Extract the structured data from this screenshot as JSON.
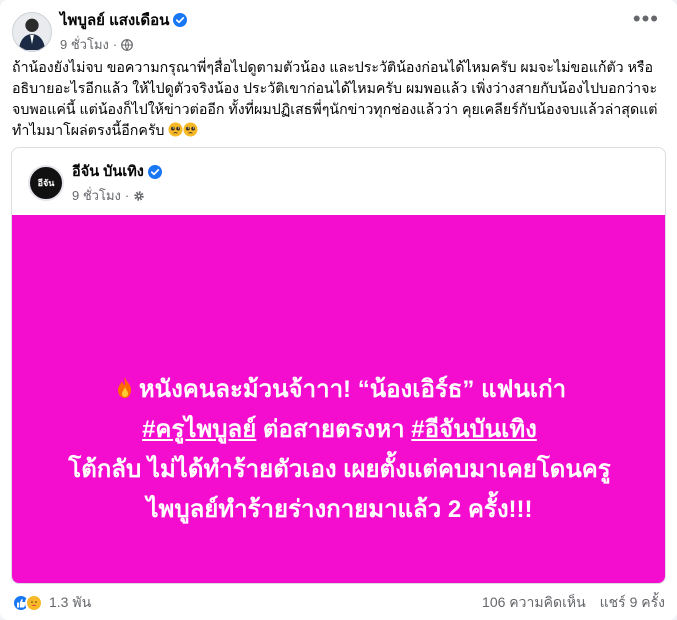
{
  "post": {
    "author": "ไพบูลย์ แสงเดือน",
    "time": "9 ชั่วโมง",
    "dot": "·",
    "more_label": "•••",
    "text": "ถ้าน้องยังไม่จบ ขอความกรุณาพี่ๆสื่อไปดูตามตัวน้อง และประวัติน้องก่อนได้ไหมครับ ผมจะไม่ขอแก้ตัว หรืออธิบายอะไรอีกแล้ว ให้ไปดูตัวจริงน้อง ประวัติเขาก่อนได้ไหมครับ ผมพอแล้ว เพิ่งว่างสายกับน้องไปบอกว่าจะจบพอแค่นี้ แต่น้องก็ไปให้ข่าวต่ออีก ทั้งที่ผมปฏิเสธพี่ๆนักข่าวทุกช่องแล้วว่า คุยเคลียร์กับน้องจบแล้วล่าสุดแต่ทำไมมาโผล่ตรงนี้อีกครับ"
  },
  "shared": {
    "page_name": "อีจัน บันเทิง",
    "logo_text": "อีจัน",
    "time": "9 ชั่วโมง",
    "dot": "·",
    "headline_part1": "หนังคนละม้วนจ้าาา! “น้องเอิร์ธ” แฟนเก่า",
    "tag1": "#ครูไพบูลย์",
    "headline_part2": " ต่อสายตรงหา ",
    "tag2": "#อีจันบันเทิง",
    "headline_part3": "โต้กลับ ไม่ได้ทำร้ายตัวเอง เผยตั้งแต่คบมาเคยโดนครูไพบูลย์ทำร้ายร่างกายมาแล้ว 2 ครั้ง!!!",
    "background_color": "#f40ccf"
  },
  "stats": {
    "reaction_count": "1.3 พัน",
    "comments": "106 ความคิดเห็น",
    "shares": "แชร์ 9 ครั้ง"
  },
  "colors": {
    "verified": "#1877f2",
    "meta_text": "#65676b"
  }
}
